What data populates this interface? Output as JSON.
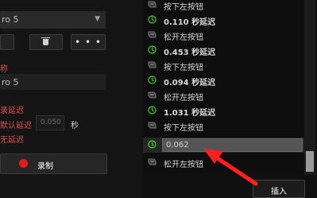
{
  "left_panel": {
    "macro_name_dropdown": "ro 5",
    "delete_icon": "trash-icon",
    "more_label": "• • •",
    "name_label": "称",
    "name_value": "ro 5",
    "record_delay_label": "录延迟",
    "default_delay_label": "默认延迟",
    "default_delay_placeholder": "0.050",
    "seconds_unit": "秒",
    "no_delay_label": "无延迟",
    "record_label": "录制"
  },
  "event_list": [
    {
      "type": "key",
      "text": "按下左按钮"
    },
    {
      "type": "delay",
      "text": "0.110 秒延迟"
    },
    {
      "type": "key",
      "text": "松开左按钮"
    },
    {
      "type": "delay",
      "text": "0.453 秒延迟"
    },
    {
      "type": "key",
      "text": "按下左按钮"
    },
    {
      "type": "delay",
      "text": "0.094 秒延迟"
    },
    {
      "type": "key",
      "text": "松开左按钮"
    },
    {
      "type": "delay",
      "text": "1.031 秒延迟"
    },
    {
      "type": "key",
      "text": "按下左按钮"
    },
    {
      "type": "delay_edit",
      "text": "0.062"
    },
    {
      "type": "key",
      "text": "松开左按钮"
    }
  ],
  "insert_label": "插入",
  "colors": {
    "accent_green": "#44d62c",
    "record_red": "#e21b1b",
    "annotation_red": "#ff1f1f"
  },
  "icons": {
    "key": "mouse-key-icon",
    "delay": "stopwatch-icon"
  }
}
